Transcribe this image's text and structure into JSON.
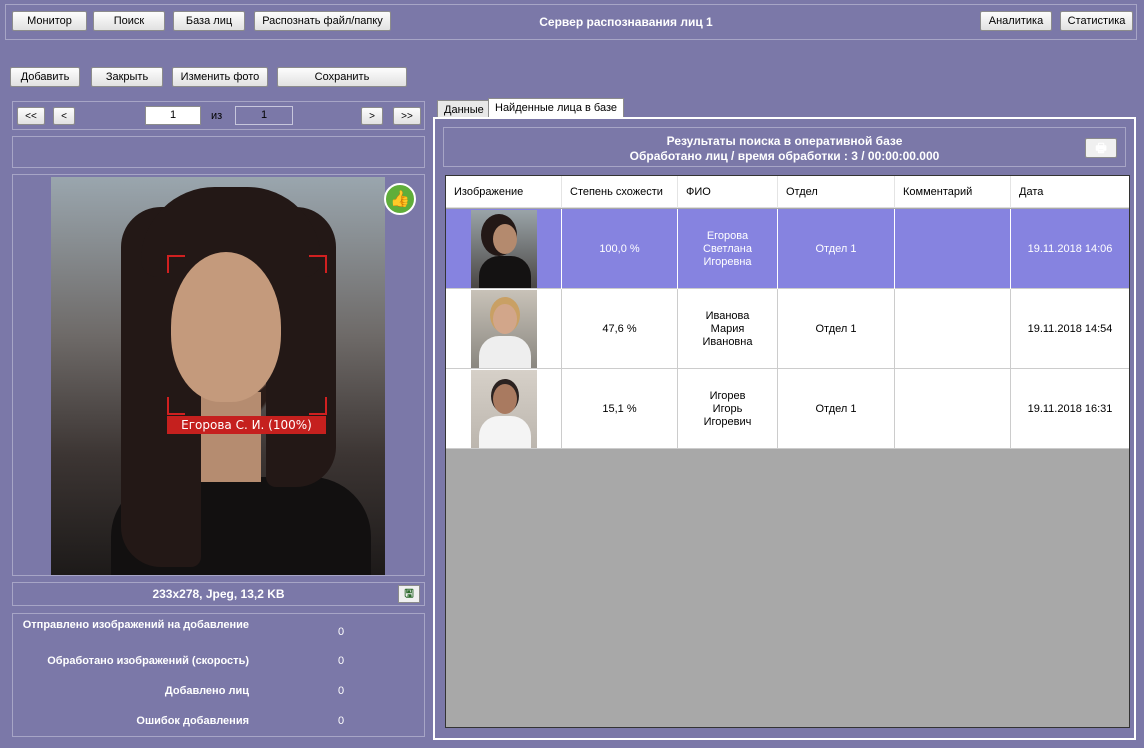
{
  "topbar": {
    "title": "Сервер распознавания лиц 1",
    "left_buttons": [
      "Монитор",
      "Поиск",
      "База лиц",
      "Распознать файл/папку"
    ],
    "right_buttons": [
      "Аналитика",
      "Статистика"
    ]
  },
  "toolbar": {
    "add": "Добавить",
    "close": "Закрыть",
    "change_photo": "Изменить фото",
    "save": "Сохранить"
  },
  "pager": {
    "first": "<<",
    "prev": "<",
    "next": ">",
    "last": ">>",
    "current": "1",
    "of_label": "из",
    "total": "1"
  },
  "photo": {
    "face_label": "Егорова С. И. (100%)",
    "info": "233x278, Jpeg, 13,2 KB",
    "thumb_icon": "thumbs-up-icon"
  },
  "stats": [
    {
      "label": "Отправлено изображений на добавление",
      "value": "0"
    },
    {
      "label": "Обработано изображений (скорость)",
      "value": "0"
    },
    {
      "label": "Добавлено лиц",
      "value": "0"
    },
    {
      "label": "Ошибок добавления",
      "value": "0"
    }
  ],
  "tabs": [
    "Данные",
    "Найденные лица в базе"
  ],
  "results": {
    "title_line1": "Результаты поиска в оперативной базе",
    "title_line2": "Обработано лиц / время обработки : 3 / 00:00:00.000"
  },
  "table": {
    "columns": [
      "Изображение",
      "Степень схожести",
      "ФИО",
      "Отдел",
      "Комментарий",
      "Дата"
    ],
    "rows": [
      {
        "similarity": "100,0 %",
        "name": "Егорова\nСветлана\nИгоревна",
        "dept": "Отдел 1",
        "comment": "",
        "date": "19.11.2018 14:06",
        "selected": true
      },
      {
        "similarity": "47,6 %",
        "name": "Иванова\nМария\nИвановна",
        "dept": "Отдел 1",
        "comment": "",
        "date": "19.11.2018 14:54",
        "selected": false
      },
      {
        "similarity": "15,1 %",
        "name": "Игорев\nИгорь\nИгоревич",
        "dept": "Отдел 1",
        "comment": "",
        "date": "19.11.2018 16:31",
        "selected": false
      }
    ]
  },
  "colors": {
    "background": "#7b78a8",
    "selected_row": "#8683e0",
    "face_box": "#d02020",
    "face_label_bg": "#c5201e",
    "thumb_icon": "#5fae3a"
  }
}
